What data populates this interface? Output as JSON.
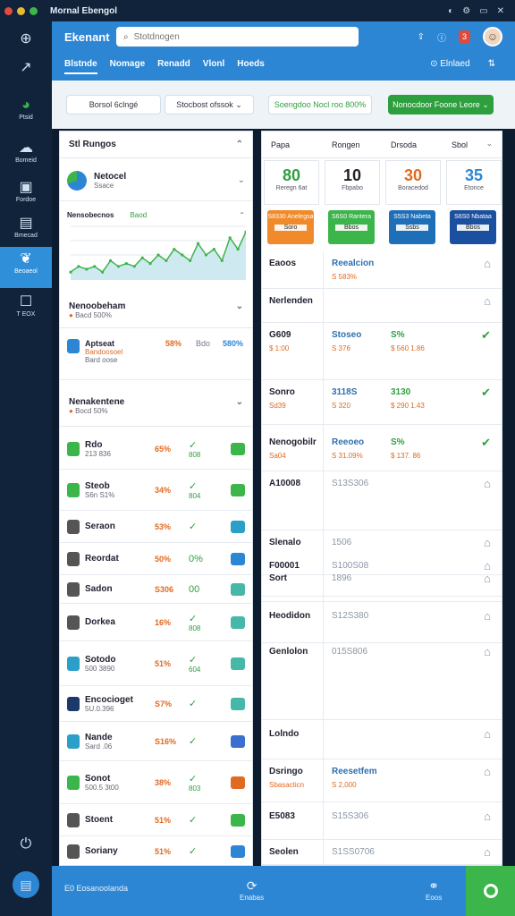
{
  "window": {
    "title": "Mornal Ebengol"
  },
  "sidebar": {
    "items": [
      {
        "label": "",
        "icon": "globe-icon"
      },
      {
        "label": "",
        "icon": "chart-icon"
      },
      {
        "label": "Ptsid",
        "icon": "pie-icon"
      },
      {
        "label": "Bomeid",
        "icon": "cloud-icon"
      },
      {
        "label": "Fordoe",
        "icon": "window-icon"
      },
      {
        "label": "Bmecad",
        "icon": "calendar-icon"
      },
      {
        "label": "Beoaeol",
        "icon": "leaf-icon"
      },
      {
        "label": "T EOX",
        "icon": "box-icon"
      }
    ]
  },
  "header": {
    "brand": "Ekenant",
    "search_placeholder": "Stotdnogen",
    "notif_count": "3",
    "tabs": [
      "Blstnde",
      "Nomage",
      "Renadd",
      "Vlonl",
      "Hoeds"
    ],
    "right_label": "Elnlaed"
  },
  "toolbar": {
    "btn1": "Borsol 6clngé",
    "btn2": "Stocbost ofssok",
    "btn3": "Soengdoo Nocl roo 800%",
    "btn4": "Nonocdoor Foone Leore"
  },
  "left": {
    "section1": "Stl Rungos",
    "item1_title": "Netocel",
    "item1_sub": "Ssace",
    "chart_title": "Nensobecnos",
    "chart_tag": "Baod",
    "section2": "Nenoobeham",
    "section2_sub": "Bacd 500%",
    "summary": {
      "name": "Aptseat",
      "pct": "58%",
      "mid": "Bdo",
      "val": "580%",
      "sub1": "Bandoosoel",
      "sub2": "Bard oose"
    },
    "section3": "Nenakentene",
    "section3_sub": "Bocd 50%",
    "rows": [
      {
        "name": "Rdo",
        "sub": "213 836",
        "pct": "65%",
        "chk": "✓",
        "chk2": "808",
        "color": "#3cb54a",
        "shape": "#3cb54a"
      },
      {
        "name": "Steob",
        "sub": "S6n S1%",
        "pct": "34%",
        "chk": "✓",
        "chk2": "804",
        "color": "#3cb54a",
        "shape": "#3cb54a"
      },
      {
        "name": "Seraon",
        "sub": "",
        "pct": "53%",
        "chk": "✓",
        "chk2": "",
        "color": "#555",
        "shape": "#2a9fc9"
      },
      {
        "name": "Reordat",
        "sub": "",
        "pct": "50%",
        "chk": "0%",
        "chk2": "",
        "color": "#555",
        "shape": "#2d86d3"
      },
      {
        "name": "Sadon",
        "sub": "",
        "pct": "S306",
        "chk": "00",
        "chk2": "",
        "color": "#555",
        "shape": "#46b8a8"
      },
      {
        "name": "Dorkea",
        "sub": "",
        "pct": "16%",
        "chk": "✓",
        "chk2": "808",
        "color": "#555",
        "shape": "#46b8a8"
      },
      {
        "name": "Sotodo",
        "sub": "500 3890",
        "pct": "51%",
        "chk": "✓",
        "chk2": "604",
        "color": "#2a9fc9",
        "shape": "#46b8a8"
      },
      {
        "name": "Encocioget",
        "sub": "5U.0.396",
        "pct": "S7%",
        "chk": "✓",
        "chk2": "",
        "color": "#1b3a6a",
        "shape": "#46b8a8"
      },
      {
        "name": "Nande",
        "sub": "Sard .06",
        "pct": "S16%",
        "chk": "✓",
        "chk2": "",
        "color": "#2a9fc9",
        "shape": "#3a6fd0"
      },
      {
        "name": "Sonot",
        "sub": "500.5 3t00",
        "pct": "38%",
        "chk": "✓",
        "chk2": "803",
        "color": "#3cb54a",
        "shape": "#e06a20"
      },
      {
        "name": "Stoent",
        "sub": "",
        "pct": "51%",
        "chk": "✓",
        "chk2": "",
        "color": "#555",
        "shape": "#3cb54a"
      },
      {
        "name": "Soriany",
        "sub": "",
        "pct": "51%",
        "chk": "✓",
        "chk2": "",
        "color": "#555",
        "shape": "#2d86d3"
      }
    ]
  },
  "right": {
    "headers": [
      "Papa",
      "Rongen",
      "Drsoda",
      "Sbol"
    ],
    "cards": [
      {
        "big": "80",
        "lbl": "Reregn 6at",
        "color": "#2e9f3e"
      },
      {
        "big": "10",
        "lbl": "Fbpabo",
        "color": "#222"
      },
      {
        "big": "30",
        "lbl": "Boracedod",
        "color": "#e06a20"
      },
      {
        "big": "35",
        "lbl": "Etonce",
        "color": "#2d86d3"
      }
    ],
    "tiles": [
      {
        "text": "S8330 Anelegsa",
        "tag": "Soro",
        "color": "#f08a2a"
      },
      {
        "text": "S6S0 Rantera",
        "tag": "Bbos",
        "color": "#3cb54a"
      },
      {
        "text": "S5S3 Nabeta",
        "tag": "Ssbs",
        "color": "#1f6fb8"
      },
      {
        "text": "S6S0 Nbataa",
        "tag": "Bbos",
        "color": "#1b4fa0"
      }
    ],
    "rows": [
      {
        "c1": "Eaoos",
        "c2": "Reealcion",
        "c3": "",
        "s1": "",
        "s2": "S 583%",
        "s3": ""
      },
      {
        "c1": "Nerlenden",
        "c2": "",
        "c3": "",
        "s1": "",
        "s2": "",
        "s3": ""
      },
      {
        "c1": "G609",
        "c2": "Stoseo",
        "c3": "S%",
        "s1": "$ 1:00",
        "s2": "S 376",
        "s3": "$ 560 1.86"
      },
      {
        "c1": "Sonro",
        "c2": "3118S",
        "c3": "3130",
        "s1": "Sd39",
        "s2": "S 320",
        "s3": "$ 290 1.43"
      },
      {
        "c1": "Nenogobilr",
        "c2": "Reeoeo",
        "c3": "S%",
        "s1": "Sa04",
        "s2": "S 31.09%",
        "s3": "$ 137. 86"
      },
      {
        "c1": "A10008",
        "c2": "S13S306",
        "c3": "",
        "s1": "",
        "s2": "",
        "s3": ""
      },
      {
        "c1": "Slenalo",
        "c2": "1506",
        "c3": "",
        "s1": "",
        "s2": "",
        "s3": ""
      },
      {
        "c1": "F00001",
        "c2": "S100S08",
        "c3": "",
        "s1": "",
        "s2": "",
        "s3": ""
      },
      {
        "c1": "Sort",
        "c2": "1896",
        "c3": "",
        "s1": "",
        "s2": "",
        "s3": ""
      },
      {
        "c1": "Heodidon",
        "c2": "S12S380",
        "c3": "",
        "s1": "",
        "s2": "",
        "s3": ""
      },
      {
        "c1": "Genlolon",
        "c2": "015S806",
        "c3": "",
        "s1": "",
        "s2": "",
        "s3": ""
      },
      {
        "c1": "Lolndo",
        "c2": "",
        "c3": "",
        "s1": "",
        "s2": "",
        "s3": ""
      },
      {
        "c1": "Dsringo",
        "c2": "Reesetfem",
        "c3": "",
        "s1": "Sbasacticn",
        "s2": "S 2,000",
        "s3": ""
      },
      {
        "c1": "E5083",
        "c2": "S15S306",
        "c3": "",
        "s1": "",
        "s2": "",
        "s3": ""
      },
      {
        "c1": "Seolen",
        "c2": "S1SS0706",
        "c3": "",
        "s1": "",
        "s2": "",
        "s3": ""
      }
    ]
  },
  "footer": {
    "left": "E0 Eosanoolanda",
    "mid": "Enabas",
    "right": "Eoos"
  },
  "chart_data": {
    "type": "area",
    "title": "Nensobecnos",
    "values": [
      2,
      3,
      2.5,
      3,
      2,
      4,
      3,
      3.5,
      3,
      4.5,
      3.5,
      5,
      4,
      6,
      5,
      4,
      7,
      5,
      6,
      4,
      8,
      6,
      9
    ],
    "ylim": [
      0,
      10
    ]
  }
}
